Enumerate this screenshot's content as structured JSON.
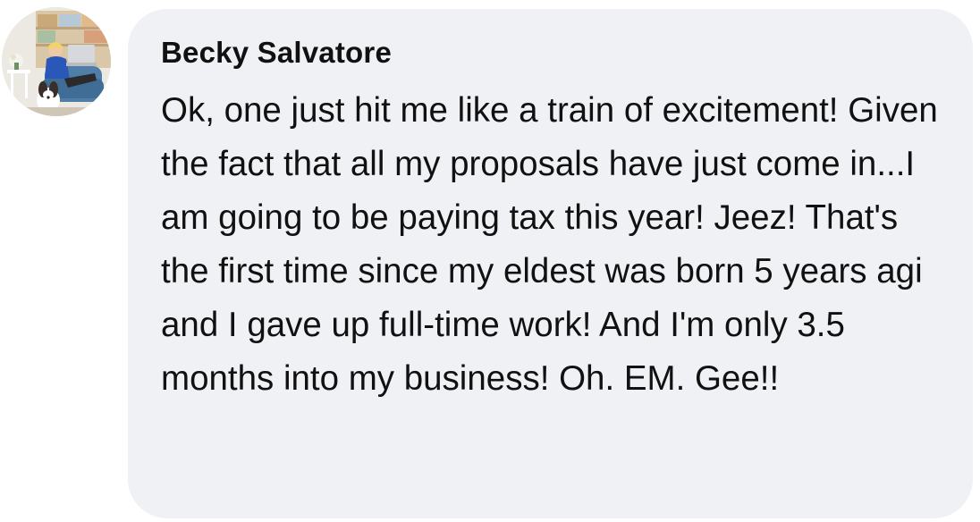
{
  "comment": {
    "author_name": "Becky Salvatore",
    "text": "Ok, one just hit me like a train of excitement! Given the fact that all my proposals have just come in...I am going to be paying tax this year! Jeez! That's the first time since my eldest was born 5 years agi and I gave up full-time work! And I'm only 3.5 months into my business! Oh. EM. Gee!!"
  },
  "colors": {
    "bubble_background": "#f0f1f5",
    "text": "#111111"
  }
}
